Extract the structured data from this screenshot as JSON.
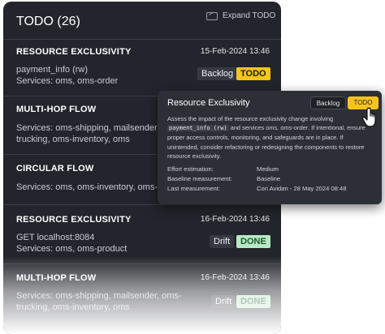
{
  "header": {
    "title": "TODO (26)",
    "expand_label": "Expand TODO"
  },
  "items": [
    {
      "title": "RESOURCE EXCLUSIVITY",
      "date": "15-Feb-2024 13:46",
      "lines": [
        "payment_info (rw)",
        "Services: oms, oms-order"
      ],
      "badges": [
        "Backlog",
        "TODO"
      ]
    },
    {
      "title": "MULTI-HOP FLOW",
      "date": "",
      "lines": [
        "Services: oms-shipping, mailsender, om",
        "trucking, oms-inventory, oms"
      ],
      "badges": []
    },
    {
      "title": "CIRCULAR FLOW",
      "date": "",
      "lines": [
        "Services: oms, oms-inventory, oms-shi"
      ],
      "badges": []
    },
    {
      "title": "RESOURCE EXCLUSIVITY",
      "date": "16-Feb-2024 13:46",
      "lines": [
        "GET localhost:8084",
        "Services: oms, oms-product"
      ],
      "badges": [
        "Drift",
        "DONE"
      ]
    },
    {
      "title": "MULTI-HOP FLOW",
      "date": "16-Feb-2024 13:46",
      "lines": [
        "Services: oms-shipping, mailsender, oms-",
        "trucking, oms-inventory, oms"
      ],
      "badges": [
        "Drift",
        "DONE"
      ]
    }
  ],
  "popover": {
    "title": "Resource Exclusivity",
    "backlog_label": "Backlog",
    "todo_label": "TODO",
    "desc_1": "Assess the impact of the resource exclusivity change involving",
    "desc_code": "payment_info (rw)",
    "desc_2": " and services ",
    "desc_services": "oms, oms-order",
    "desc_3": ". If intentional, ensure proper access controls, monitoring, and safeguards are in place. If unintended, consider refactoring or redesigning the components to restore resource exclusivity.",
    "fields": [
      {
        "label": "Effort estimation:",
        "value": "Medium"
      },
      {
        "label": "Baseline measurement:",
        "value": "Baseline"
      },
      {
        "label": "Last measurement:",
        "value": "Cori Avidan - 28 May 2024 08:48"
      }
    ]
  },
  "colors": {
    "panel_bg": "#22252c",
    "todo_yellow": "#f5c518",
    "done_green": "#b8e8c4"
  }
}
